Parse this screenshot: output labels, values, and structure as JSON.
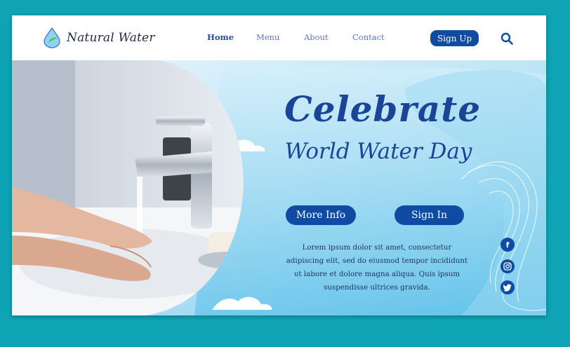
{
  "brand": {
    "name": "Natural Water"
  },
  "nav": {
    "items": [
      "Home",
      "Menu",
      "About",
      "Contact"
    ],
    "active": "Home"
  },
  "header": {
    "signup_label": "Sign Up"
  },
  "hero": {
    "title_line1": "Celebrate",
    "title_line2": "World Water Day",
    "more_info_label": "More Info",
    "sign_in_label": "Sign In",
    "body": "Lorem ipsum dolor sit amet, consectetur adipiscing elit, sed do eiusmod tempor incididunt ut labore et dolore magna aliqua. Quis ipsum suspendisse ultrices gravida."
  },
  "social": {
    "icons": [
      "facebook-icon",
      "instagram-icon",
      "twitter-icon"
    ]
  },
  "colors": {
    "background": "#0ea3b5",
    "primary": "#0f4aa3",
    "title": "#1a4596",
    "water": "#6cc7ea"
  }
}
